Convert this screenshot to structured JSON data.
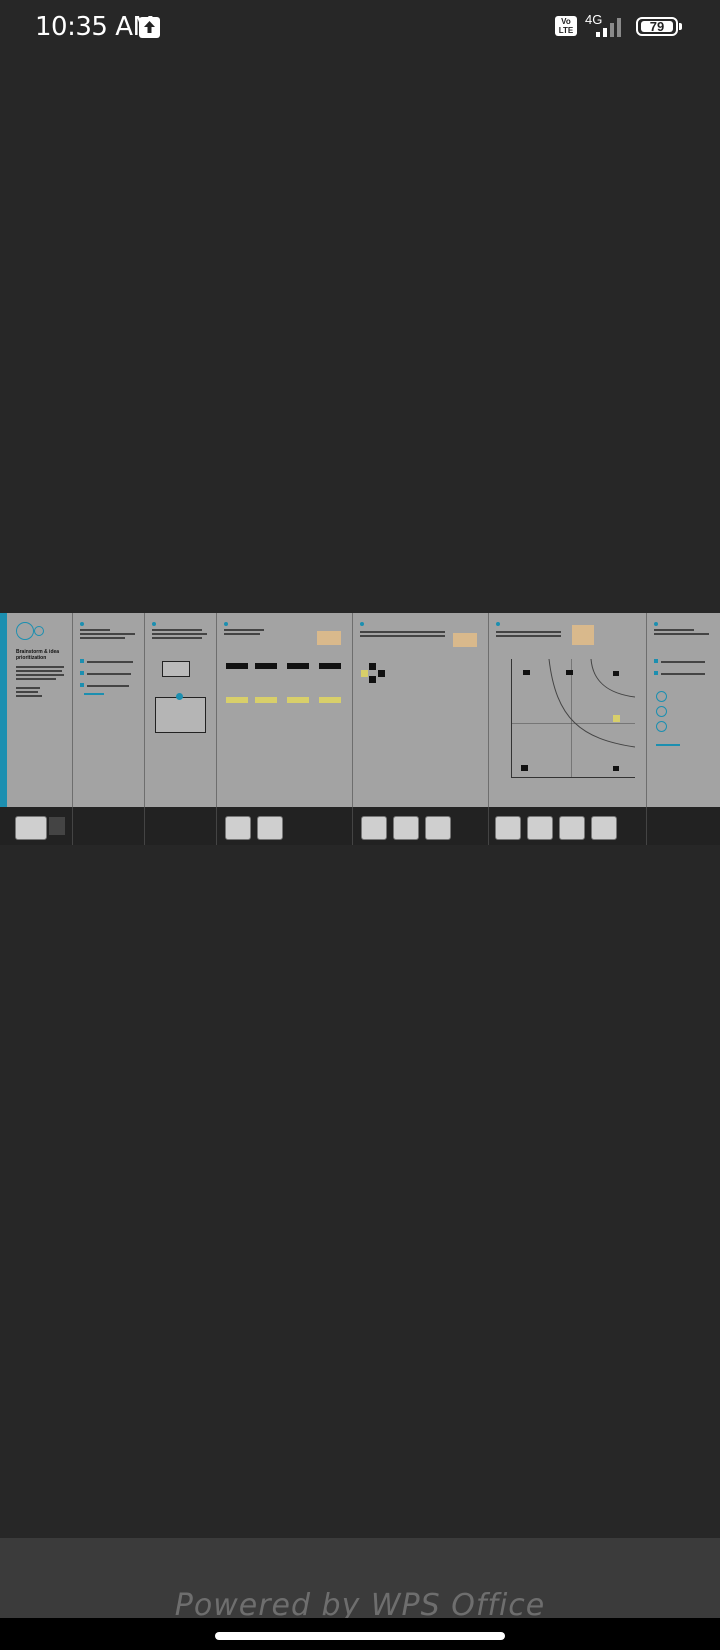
{
  "status_bar": {
    "time": "10:35 AM",
    "volte_label": "Vo\nLTE",
    "network": "4G",
    "battery": "79",
    "icons": [
      "upload-icon",
      "volte-icon",
      "signal-icon",
      "battery-icon"
    ]
  },
  "document": {
    "cover_title": "Brainstorm & idea prioritization",
    "panels": [
      "cover",
      "set-goal",
      "define-problem",
      "brainstorm",
      "group-ideas",
      "prioritize",
      "after-workshop"
    ]
  },
  "footer": {
    "branding": "Powered by WPS Office"
  },
  "colors": {
    "background": "#272727",
    "accent": "#1c8fb0",
    "sticky": "#d8cf6a",
    "branding_text": "#6e6e6e"
  }
}
